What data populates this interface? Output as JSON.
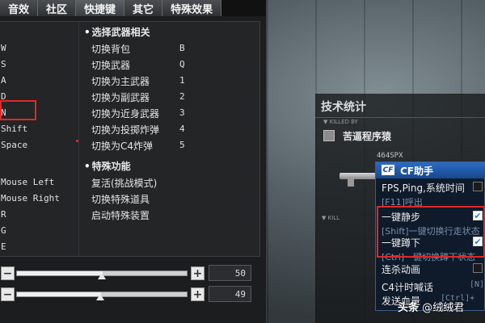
{
  "tabs": [
    "音效",
    "社区",
    "快捷键",
    "其它",
    "特殊效果"
  ],
  "weapons_section": {
    "title": "选择武器相关",
    "rows": [
      {
        "key": "W",
        "action": "切换背包",
        "hotkey": "B"
      },
      {
        "key": "S",
        "action": "切换武器",
        "hotkey": "Q"
      },
      {
        "key": "A",
        "action": "切换为主武器",
        "hotkey": "1"
      },
      {
        "key": "D",
        "action": "切换为副武器",
        "hotkey": "2"
      },
      {
        "key": "N",
        "action": "切换为近身武器",
        "hotkey": "3"
      },
      {
        "key": "Shift",
        "action": "切换为投掷炸弹",
        "hotkey": "4"
      },
      {
        "key": "Space",
        "action": "切换为C4炸弹",
        "hotkey": "5"
      }
    ]
  },
  "special_section": {
    "title": "特殊功能",
    "rows": [
      {
        "key": "Mouse Left",
        "action": "复活(挑战模式)"
      },
      {
        "key": "Mouse Right",
        "action": "切换特殊道具"
      },
      {
        "key": "R",
        "action": "启动特殊装置"
      },
      {
        "key": "G",
        "action": ""
      },
      {
        "key": "E",
        "action": ""
      }
    ]
  },
  "sliders": [
    {
      "value": "50",
      "level": 0.5
    },
    {
      "value": "49",
      "level": 0.49
    }
  ],
  "stats": {
    "title": "技术统计",
    "killed_by_label": "KILLED BY",
    "killer_name": "苦逼程序猿",
    "weapon": "464SPX",
    "kill_label": "KILL"
  },
  "helper": {
    "title": "CF助手",
    "logo": "CF",
    "options": [
      {
        "label": "FPS,Ping,系统时间",
        "hint": "[F11]呼出",
        "checked": false
      },
      {
        "label": "一键静步",
        "hint": "[Shift]一键切换行走状态",
        "checked": true
      },
      {
        "label": "一键蹲下",
        "hint": "[Ctrl]一键切换蹲下状态",
        "checked": true
      },
      {
        "label": "连杀动画",
        "hint": "",
        "checked": false
      },
      {
        "label": "C4计时喊话",
        "hint": "",
        "side": "[N]"
      },
      {
        "label": "发送血量",
        "hint": "",
        "side": "[Ctrl]+[H]"
      }
    ]
  },
  "watermark": {
    "logo": "头条",
    "text": "@绒绒君"
  },
  "colors": {
    "highlight_red": "#e02828",
    "helper_blue": "#2d6bc4",
    "check_blue": "#2f7be0"
  }
}
